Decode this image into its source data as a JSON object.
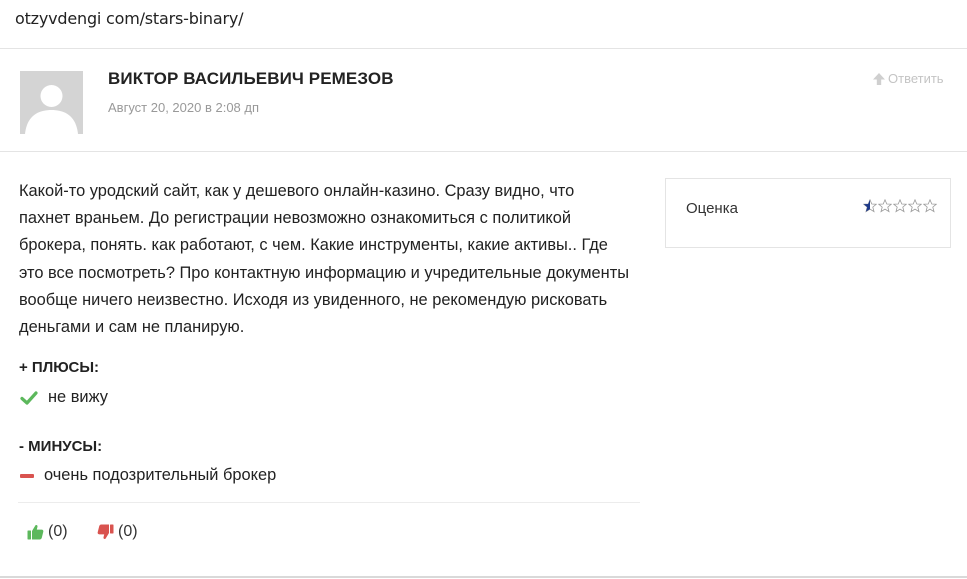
{
  "browser": {
    "url": "otzyvdengi com/stars-binary/"
  },
  "review": {
    "author": "ВИКТОР ВАСИЛЬЕВИЧ РЕМЕЗОВ",
    "date": "Август 20, 2020 в 2:08 дп",
    "reply_label": "Ответить",
    "text": "Какой-то уродский сайт, как у дешевого онлайн-казино. Сразу видно, что пахнет враньем. До регистрации невозможно ознакомиться с политикой брокера, понять. как работают, с чем. Какие инструменты, какие активы.. Где это все посмотреть? Про контактную информацию и учредительные документы вообще ничего неизвестно. Исходя из увиденного, не рекомендую рисковать деньгами и сам не планирую.",
    "rating": {
      "label": "Оценка",
      "value": 0.5,
      "max": 5
    },
    "pros": {
      "title": "+ ПЛЮСЫ:",
      "items": [
        "не вижу"
      ]
    },
    "cons": {
      "title": "- МИНУСЫ:",
      "items": [
        "очень подозрительный брокер"
      ]
    },
    "votes": {
      "up": "(0)",
      "down": "(0)"
    }
  },
  "icons": {
    "avatar": "avatar-placeholder-icon",
    "reply": "arrow-up-icon",
    "check": "check-icon",
    "minus": "minus-icon",
    "thumbs_up": "thumbs-up-icon",
    "thumbs_down": "thumbs-down-icon",
    "star": "star-icon"
  },
  "colors": {
    "green": "#5cb85c",
    "red": "#d9534f",
    "star": "#1e3a8a",
    "muted": "#999999"
  }
}
